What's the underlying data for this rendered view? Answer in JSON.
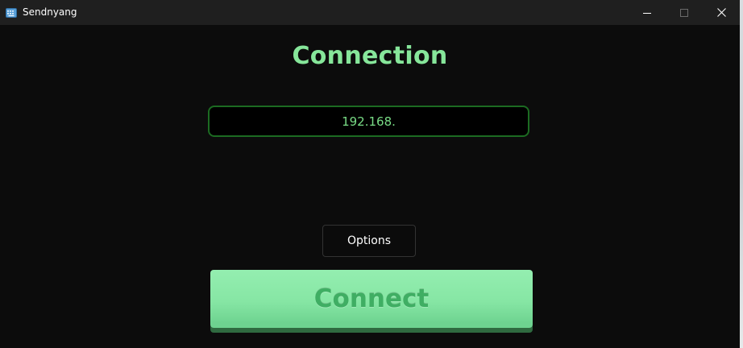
{
  "window": {
    "title": "Sendnyang",
    "icon": "keyboard-icon",
    "controls": [
      "minimize-icon",
      "maximize-icon",
      "close-icon"
    ]
  },
  "main": {
    "heading": "Connection",
    "ip_field": {
      "value": "192.168."
    },
    "options_label": "Options",
    "connect_label": "Connect"
  },
  "colors": {
    "accent": "#86e69a",
    "input_border": "#1c6b22",
    "connect_bg": "#8ae9a6",
    "connect_text": "#3fae63",
    "background": "#0c0c0c"
  }
}
